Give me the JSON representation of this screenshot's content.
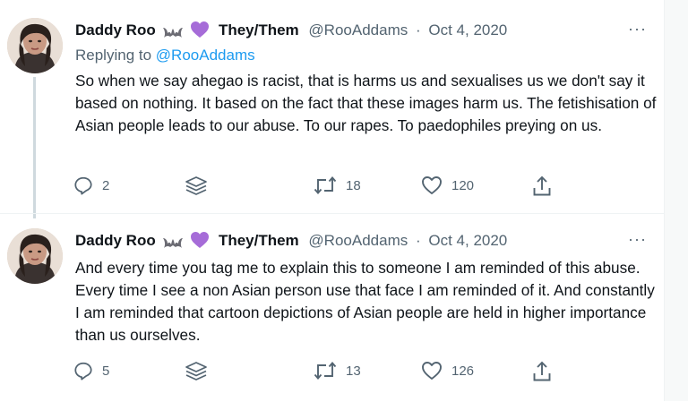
{
  "tweets": [
    {
      "name": "Daddy Roo",
      "pronouns": "They/Them",
      "handle": "@RooAddams",
      "separator": "·",
      "date": "Oct 4, 2020",
      "replying_label": "Replying to",
      "replying_to": "@RooAddams",
      "text": "So when we say ahegao is racist, that is harms us and sexualises us we don't say it based on nothing. It based on the fact that these images harm us. The fetishisation of Asian people leads to our abuse. To our rapes. To paedophiles preying on us.",
      "replies": "2",
      "retweets": "18",
      "likes": "120",
      "more": "···"
    },
    {
      "name": "Daddy Roo",
      "pronouns": "They/Them",
      "handle": "@RooAddams",
      "separator": "·",
      "date": "Oct 4, 2020",
      "text": "And every time you tag me to explain this to someone I am reminded of this abuse. Every time I see a non Asian person use that face I am reminded of it. And constantly I am reminded that cartoon depictions of Asian people are held in higher importance than us ourselves.",
      "replies": "5",
      "retweets": "13",
      "likes": "126",
      "more": "···"
    }
  ],
  "icons": [
    "bat-emoji",
    "purple-heart-emoji",
    "reply-icon",
    "stack-icon",
    "retweet-icon",
    "like-icon",
    "share-icon",
    "more-icon"
  ],
  "colors": {
    "link": "#1d9bf0",
    "muted": "#536471",
    "text": "#0f1419",
    "heart": "#a66cd8"
  }
}
